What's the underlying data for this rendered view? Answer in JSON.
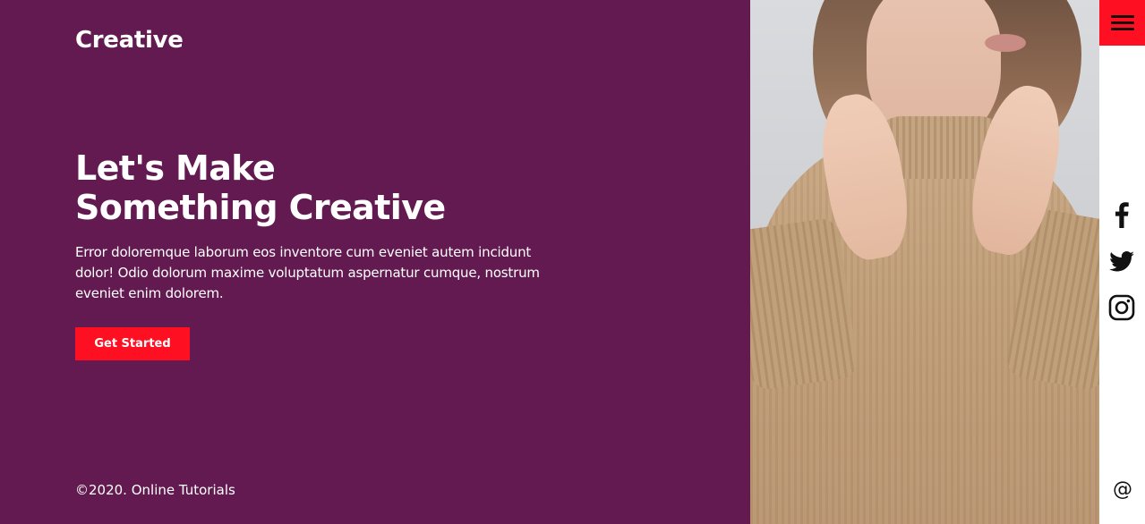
{
  "brand": {
    "logo": "Creative"
  },
  "hero": {
    "title_line1": "Let's Make",
    "title_line2": "Something Creative",
    "description": "Error doloremque laborum eos inventore cum eveniet autem incidunt dolor! Odio dolorum maxime voluptatum aspernatur cumque, nostrum eveniet enim dolorem.",
    "cta_label": "Get Started"
  },
  "footer": {
    "copyright": "©2020. Online Tutorials"
  },
  "sidebar": {
    "menu_icon": "hamburger-menu-icon",
    "social": [
      {
        "name": "facebook-icon"
      },
      {
        "name": "twitter-icon"
      },
      {
        "name": "instagram-icon"
      }
    ],
    "email_icon": "at-sign-icon",
    "email_glyph": "@"
  },
  "colors": {
    "panel_background": "#621a50",
    "accent": "#ff0f22",
    "text_light": "#ffffff",
    "sidebar_background": "#ffffff",
    "icon_dark": "#111111"
  }
}
